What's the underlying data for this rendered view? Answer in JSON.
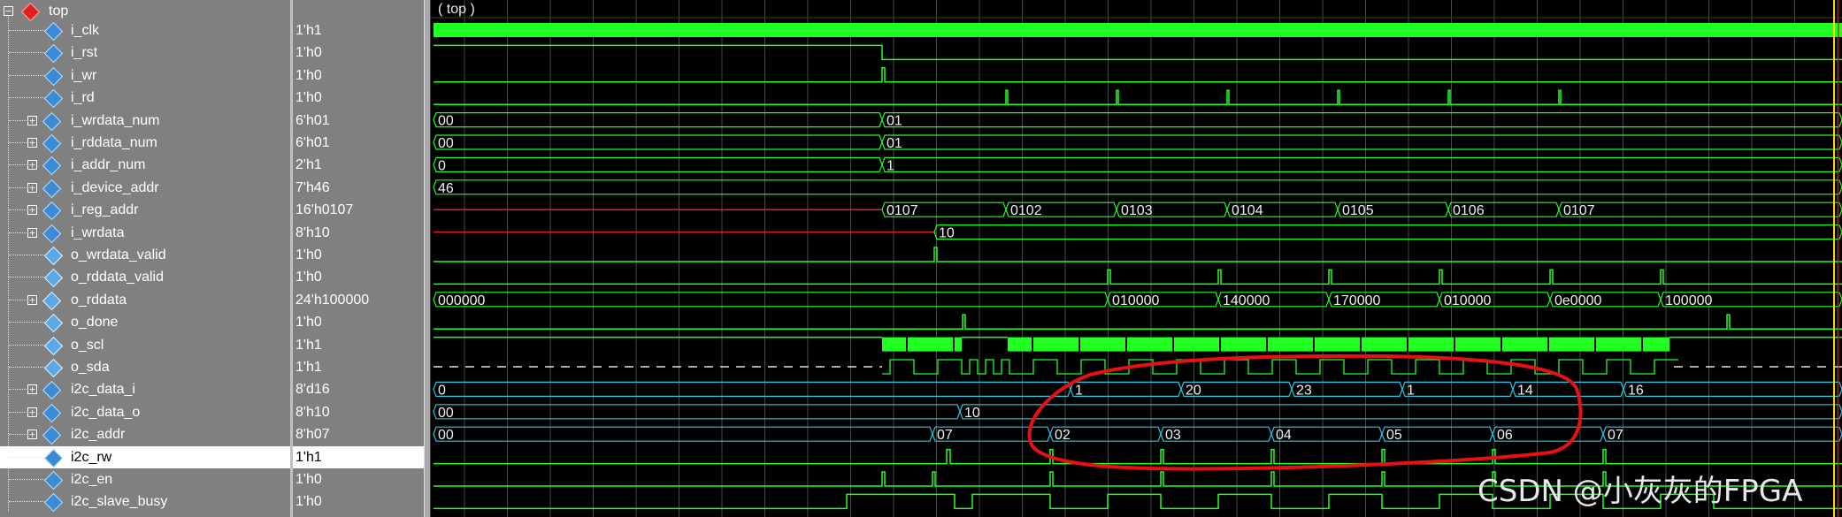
{
  "scope": {
    "name": "top",
    "wave_label": "( top )"
  },
  "signals": [
    {
      "name": "i_clk",
      "value": "1'h1",
      "dir": "in",
      "expandable": false
    },
    {
      "name": "i_rst",
      "value": "1'h0",
      "dir": "in",
      "expandable": false
    },
    {
      "name": "i_wr",
      "value": "1'h0",
      "dir": "in",
      "expandable": false
    },
    {
      "name": "i_rd",
      "value": "1'h0",
      "dir": "in",
      "expandable": false
    },
    {
      "name": "i_wrdata_num",
      "value": "6'h01",
      "dir": "in",
      "expandable": true
    },
    {
      "name": "i_rddata_num",
      "value": "6'h01",
      "dir": "in",
      "expandable": true
    },
    {
      "name": "i_addr_num",
      "value": "2'h1",
      "dir": "in",
      "expandable": true
    },
    {
      "name": "i_device_addr",
      "value": "7'h46",
      "dir": "in",
      "expandable": true
    },
    {
      "name": "i_reg_addr",
      "value": "16'h0107",
      "dir": "in",
      "expandable": true
    },
    {
      "name": "i_wrdata",
      "value": "8'h10",
      "dir": "in",
      "expandable": true
    },
    {
      "name": "o_wrdata_valid",
      "value": "1'h0",
      "dir": "out",
      "expandable": false
    },
    {
      "name": "o_rddata_valid",
      "value": "1'h0",
      "dir": "out",
      "expandable": false
    },
    {
      "name": "o_rddata",
      "value": "24'h100000",
      "dir": "out",
      "expandable": true
    },
    {
      "name": "o_done",
      "value": "1'h0",
      "dir": "out",
      "expandable": false
    },
    {
      "name": "o_scl",
      "value": "1'h1",
      "dir": "out",
      "expandable": false
    },
    {
      "name": "o_sda",
      "value": "1'h1",
      "dir": "out",
      "expandable": false
    },
    {
      "name": "i2c_data_i",
      "value": "8'd16",
      "dir": "in",
      "expandable": true
    },
    {
      "name": "i2c_data_o",
      "value": "8'h10",
      "dir": "in",
      "expandable": true
    },
    {
      "name": "i2c_addr",
      "value": "8'h07",
      "dir": "in",
      "expandable": true
    },
    {
      "name": "i2c_rw",
      "value": "1'h1",
      "dir": "in",
      "expandable": false,
      "selected": true
    },
    {
      "name": "i2c_en",
      "value": "1'h0",
      "dir": "in",
      "expandable": false
    },
    {
      "name": "i2c_slave_busy",
      "value": "1'h0",
      "dir": "in",
      "expandable": false
    }
  ],
  "bus_labels": {
    "i_wrdata_num": [
      "00",
      "01"
    ],
    "i_rddata_num": [
      "00",
      "01"
    ],
    "i_addr_num": [
      "0",
      "1"
    ],
    "i_device_addr": [
      "46"
    ],
    "i_reg_addr": [
      "0107",
      "0102",
      "0103",
      "0104",
      "0105",
      "0106",
      "0107"
    ],
    "i_wrdata": [
      "10"
    ],
    "o_rddata": [
      "000000",
      "010000",
      "140000",
      "170000",
      "010000",
      "0e0000",
      "100000"
    ],
    "i2c_data_i": [
      "0",
      "1",
      "20",
      "23",
      "1",
      "14",
      "16"
    ],
    "i2c_data_o": [
      "00",
      "10"
    ],
    "i2c_addr": [
      "00",
      "07",
      "02",
      "03",
      "04",
      "05",
      "06",
      "07"
    ]
  },
  "colors": {
    "wave_green": "#22ff22",
    "bus_cyan": "#28c8e8",
    "undefined_red": "#e02020",
    "cursor_yellow": "#ffd800",
    "annotation_red": "#e81010"
  },
  "watermark": "CSDN @小灰灰的FPGA"
}
